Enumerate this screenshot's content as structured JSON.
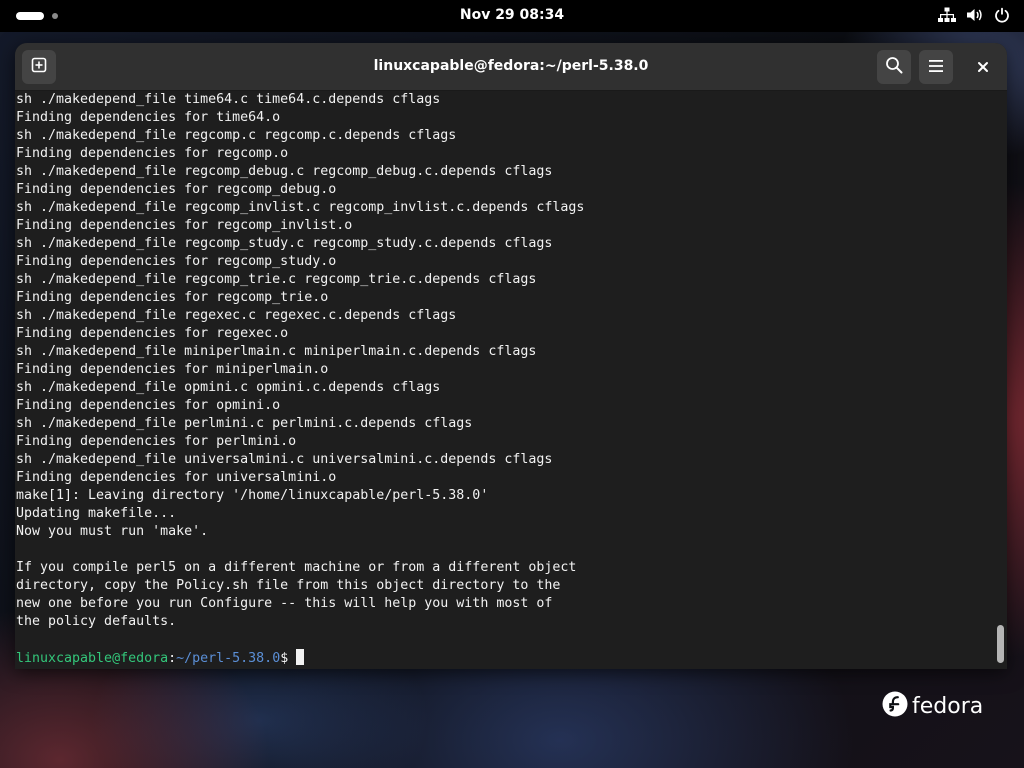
{
  "topbar": {
    "clock": "Nov 29  08:34",
    "icons": [
      "network-icon",
      "volume-icon",
      "power-icon"
    ]
  },
  "window": {
    "title": "linuxcapable@fedora:~/perl-5.38.0",
    "buttons": [
      "new-tab-icon",
      "search-icon",
      "menu-icon",
      "close-icon"
    ]
  },
  "terminal": {
    "lines": [
      "sh ./makedepend_file time64.c time64.c.depends cflags",
      "Finding dependencies for time64.o",
      "sh ./makedepend_file regcomp.c regcomp.c.depends cflags",
      "Finding dependencies for regcomp.o",
      "sh ./makedepend_file regcomp_debug.c regcomp_debug.c.depends cflags",
      "Finding dependencies for regcomp_debug.o",
      "sh ./makedepend_file regcomp_invlist.c regcomp_invlist.c.depends cflags",
      "Finding dependencies for regcomp_invlist.o",
      "sh ./makedepend_file regcomp_study.c regcomp_study.c.depends cflags",
      "Finding dependencies for regcomp_study.o",
      "sh ./makedepend_file regcomp_trie.c regcomp_trie.c.depends cflags",
      "Finding dependencies for regcomp_trie.o",
      "sh ./makedepend_file regexec.c regexec.c.depends cflags",
      "Finding dependencies for regexec.o",
      "sh ./makedepend_file miniperlmain.c miniperlmain.c.depends cflags",
      "Finding dependencies for miniperlmain.o",
      "sh ./makedepend_file opmini.c opmini.c.depends cflags",
      "Finding dependencies for opmini.o",
      "sh ./makedepend_file perlmini.c perlmini.c.depends cflags",
      "Finding dependencies for perlmini.o",
      "sh ./makedepend_file universalmini.c universalmini.c.depends cflags",
      "Finding dependencies for universalmini.o",
      "make[1]: Leaving directory '/home/linuxcapable/perl-5.38.0'",
      "Updating makefile...",
      "Now you must run 'make'.",
      "",
      "If you compile perl5 on a different machine or from a different object",
      "directory, copy the Policy.sh file from this object directory to the",
      "new one before you run Configure -- this will help you with most of",
      "the policy defaults.",
      ""
    ],
    "prompt": {
      "user_host": "linuxcapable@fedora",
      "separator": ":",
      "path": "~/perl-5.38.0",
      "symbol": "$ "
    }
  },
  "desktop": {
    "logo_text": "fedora"
  }
}
